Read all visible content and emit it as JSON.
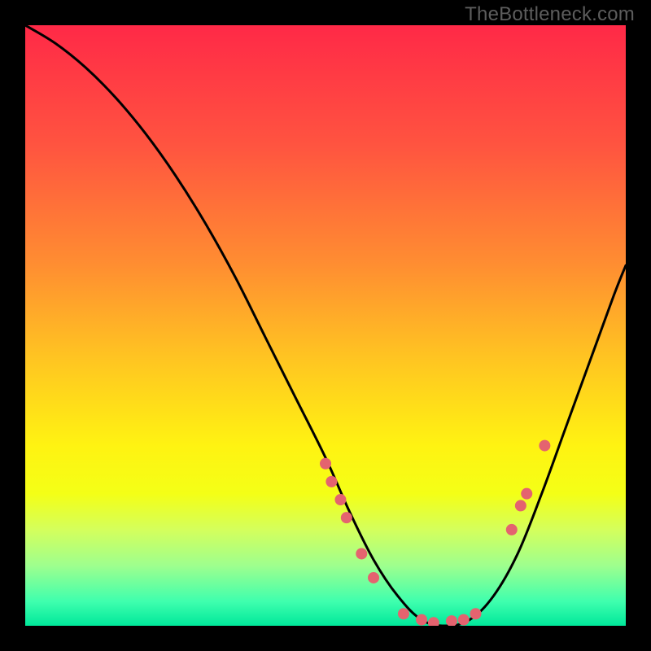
{
  "watermark": "TheBottleneck.com",
  "chart_data": {
    "type": "line",
    "title": "",
    "xlabel": "",
    "ylabel": "",
    "xlim": [
      0,
      100
    ],
    "ylim": [
      0,
      100
    ],
    "grid": false,
    "legend": false,
    "series": [
      {
        "name": "curve",
        "x": [
          0,
          5,
          10,
          15,
          20,
          25,
          30,
          35,
          40,
          45,
          50,
          54,
          58,
          62,
          66,
          70,
          74,
          78,
          82,
          86,
          90,
          94,
          98,
          100
        ],
        "y": [
          100,
          97,
          93,
          88,
          82,
          75,
          67,
          58,
          48,
          38,
          28,
          19,
          11,
          5,
          1,
          0,
          1,
          5,
          12,
          22,
          33,
          44,
          55,
          60
        ]
      }
    ],
    "markers": {
      "name": "dots",
      "color": "#e4636f",
      "radius": 7,
      "points": [
        {
          "x": 50.0,
          "y": 27.0
        },
        {
          "x": 51.0,
          "y": 24.0
        },
        {
          "x": 52.5,
          "y": 21.0
        },
        {
          "x": 53.5,
          "y": 18.0
        },
        {
          "x": 56.0,
          "y": 12.0
        },
        {
          "x": 58.0,
          "y": 8.0
        },
        {
          "x": 63.0,
          "y": 2.0
        },
        {
          "x": 66.0,
          "y": 1.0
        },
        {
          "x": 68.0,
          "y": 0.5
        },
        {
          "x": 71.0,
          "y": 0.8
        },
        {
          "x": 73.0,
          "y": 1.0
        },
        {
          "x": 75.0,
          "y": 2.0
        },
        {
          "x": 81.0,
          "y": 16.0
        },
        {
          "x": 82.5,
          "y": 20.0
        },
        {
          "x": 83.5,
          "y": 22.0
        },
        {
          "x": 86.5,
          "y": 30.0
        }
      ]
    },
    "background_gradient": {
      "stops": [
        {
          "offset": 0.0,
          "color": "#ff2947"
        },
        {
          "offset": 0.2,
          "color": "#ff5440"
        },
        {
          "offset": 0.4,
          "color": "#ff8e31"
        },
        {
          "offset": 0.55,
          "color": "#ffc322"
        },
        {
          "offset": 0.7,
          "color": "#fff312"
        },
        {
          "offset": 0.78,
          "color": "#f4ff16"
        },
        {
          "offset": 0.84,
          "color": "#d4ff5c"
        },
        {
          "offset": 0.9,
          "color": "#9eff8e"
        },
        {
          "offset": 0.96,
          "color": "#3effae"
        },
        {
          "offset": 1.0,
          "color": "#00e89a"
        }
      ]
    }
  }
}
